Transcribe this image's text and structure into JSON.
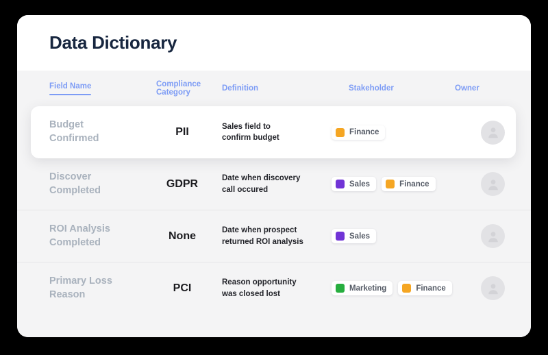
{
  "window": {
    "background_color": "#000000",
    "card_background": "#ffffff"
  },
  "header": {
    "title": "Data Dictionary",
    "title_color": "#17263f"
  },
  "table": {
    "header_accent_color": "#7d9cf5",
    "columns": [
      {
        "label": "Field Name",
        "key": "field_name",
        "active": true
      },
      {
        "label": "Compliance Category",
        "key": "compliance_category",
        "active": false
      },
      {
        "label": "Definition",
        "key": "definition",
        "active": false
      },
      {
        "label": "Stakeholder",
        "key": "stakeholder",
        "active": false
      },
      {
        "label": "Owner",
        "key": "owner",
        "active": false
      }
    ],
    "rows": [
      {
        "field_name": "Budget Confirmed",
        "field_name_line1": "Budget",
        "field_name_line2": "Confirmed",
        "compliance_category": "PII",
        "definition_line1": "Sales field to",
        "definition_line2": "confirm budget",
        "stakeholders": [
          {
            "label": "Finance",
            "color": "#f5a623"
          }
        ],
        "owner_avatar": "user-avatar",
        "selected": true
      },
      {
        "field_name": "Discover Completed",
        "field_name_line1": "Discover",
        "field_name_line2": "Completed",
        "compliance_category": "GDPR",
        "definition_line1": "Date when discovery",
        "definition_line2": "call occured",
        "stakeholders": [
          {
            "label": "Sales",
            "color": "#7134d6"
          },
          {
            "label": "Finance",
            "color": "#f5a623"
          }
        ],
        "owner_avatar": "user-avatar",
        "selected": false
      },
      {
        "field_name": "ROI Analysis Completed",
        "field_name_line1": "ROI Analysis",
        "field_name_line2": "Completed",
        "compliance_category": "None",
        "definition_line1": "Date when prospect",
        "definition_line2": "returned ROI analysis",
        "stakeholders": [
          {
            "label": "Sales",
            "color": "#7134d6"
          }
        ],
        "owner_avatar": "user-avatar",
        "selected": false
      },
      {
        "field_name": "Primary Loss Reason",
        "field_name_line1": "Primary Loss",
        "field_name_line2": "Reason",
        "compliance_category": "PCI",
        "definition_line1": "Reason opportunity",
        "definition_line2": "was closed lost",
        "stakeholders": [
          {
            "label": "Marketing",
            "color": "#27ae3f"
          },
          {
            "label": "Finance",
            "color": "#f5a623"
          }
        ],
        "owner_avatar": "user-avatar",
        "selected": false
      }
    ]
  }
}
